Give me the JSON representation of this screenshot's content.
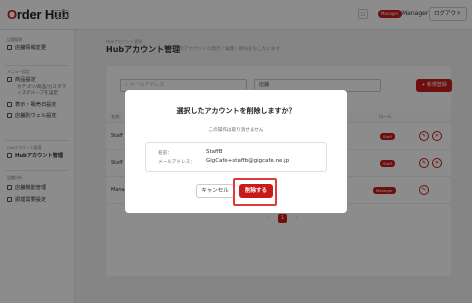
{
  "header": {
    "logo_prefix": "O",
    "logo_rest": "rder Hub",
    "env_badge": "STG",
    "role_badge": "Manager",
    "user_name": "Manager",
    "logout_label": "ログアウト"
  },
  "sidebar": {
    "section_store": "店舗管理",
    "store_info": "店舗情報変更",
    "section_menu": "メニュー設定",
    "product_settings": "商品設定",
    "product_sub": [
      "カテゴリ/商品/カスタマ",
      "イズグループを設定"
    ],
    "display_settings": "表示・販売日設定",
    "store_menu_map": "店舗別ウェル設定",
    "section_hub": "Hubアカウント管理",
    "hub_accounts": "Hubアカウント管理",
    "section_analysis": "店舗分析",
    "store_analysis": "店舗機能管理",
    "report": "調理需要設定"
  },
  "page": {
    "breadcrumb": "Hubアカウント管理",
    "title": "Hubアカウント管理",
    "subtitle": "Hubのアカウントの発行 / 編集 / 削除をおこないます"
  },
  "toolbar": {
    "search_placeholder": "メールアドレス",
    "select_value": "店舗",
    "new_button": "+ 新規登録"
  },
  "table": {
    "col_name": "名前",
    "col_role": "ロール",
    "rows": [
      {
        "name": "Staff",
        "role": "Staff"
      },
      {
        "name": "Staff",
        "role": "Staff"
      },
      {
        "name": "Manager",
        "role": "Manager"
      }
    ]
  },
  "pagination": {
    "prev": "‹",
    "current": "1",
    "next": "›"
  },
  "modal": {
    "title": "選択したアカウントを削除しますか？",
    "note": "この操作は取り消せません",
    "name_label": "名前：",
    "name_value": "StaffB",
    "email_label": "メールアドレス：",
    "email_value": "GigCafe+staffb@gigcafe.ne.jp",
    "cancel_label": "キャンセル",
    "delete_label": "削除する"
  },
  "colors": {
    "accent": "#c91a1a",
    "focus_ring": "#e03a3a"
  }
}
